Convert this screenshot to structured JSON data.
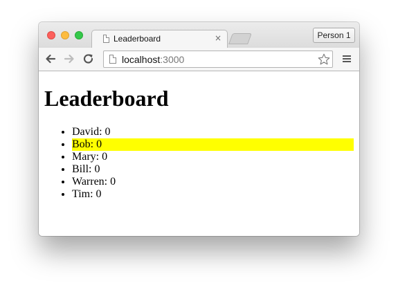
{
  "browser": {
    "tab_title": "Leaderboard",
    "tab_close": "×",
    "profile_label": "Person 1",
    "url_host": "localhost",
    "url_port": ":3000"
  },
  "page": {
    "heading": "Leaderboard",
    "players": [
      {
        "name": "David",
        "score": "0",
        "text": "David: 0",
        "selected": false
      },
      {
        "name": "Bob",
        "score": "0",
        "text": "Bob: 0",
        "selected": true
      },
      {
        "name": "Mary",
        "score": "0",
        "text": "Mary: 0",
        "selected": false
      },
      {
        "name": "Bill",
        "score": "0",
        "text": "Bill: 0",
        "selected": false
      },
      {
        "name": "Warren",
        "score": "0",
        "text": "Warren: 0",
        "selected": false
      },
      {
        "name": "Tim",
        "score": "0",
        "text": "Tim: 0",
        "selected": false
      }
    ]
  },
  "colors": {
    "selected_highlight": "#ffff00",
    "close_red": "#fc605c",
    "minimize_yellow": "#fdbc40",
    "zoom_green": "#34c84a"
  },
  "icons": [
    "back-arrow-icon",
    "forward-arrow-icon",
    "reload-icon",
    "page-icon",
    "star-icon",
    "hamburger-menu-icon"
  ]
}
